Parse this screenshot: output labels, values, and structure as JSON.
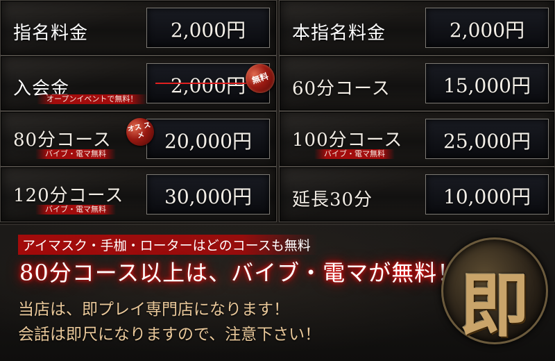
{
  "rows": [
    {
      "left": {
        "label": "指名料金",
        "price": "2,000円"
      },
      "right": {
        "label": "本指名料金",
        "price": "2,000円"
      }
    },
    {
      "left": {
        "label": "入会金",
        "price": "2,000円",
        "note": "オープンイベントで無料！",
        "badge": "無料"
      },
      "right": {
        "label": "60分コース",
        "price": "15,000円"
      }
    },
    {
      "left": {
        "label": "80分コース",
        "price": "20,000円",
        "note": "バイブ・電マ無料",
        "badge": "オス スメ"
      },
      "right": {
        "label": "100分コース",
        "price": "25,000円",
        "note": "バイブ・電マ無料"
      }
    },
    {
      "left": {
        "label": "120分コース",
        "price": "30,000円",
        "note": "バイブ・電マ無料"
      },
      "right": {
        "label": "延長30分",
        "price": "10,000円"
      }
    }
  ],
  "bottom": {
    "line1": "アイマスク・手枷・ローターはどのコースも無料",
    "line2": "80分コース以上は、バイブ・電マが無料！",
    "line3": "当店は、即プレイ専門店になります！",
    "line4": "会話は即尺になりますので、注意下さい！",
    "medal_char": "即"
  },
  "colors": {
    "accent_red": "#aa0c0c",
    "gold_text": "#e9c89a",
    "glow_red": "#ff1a1a"
  }
}
